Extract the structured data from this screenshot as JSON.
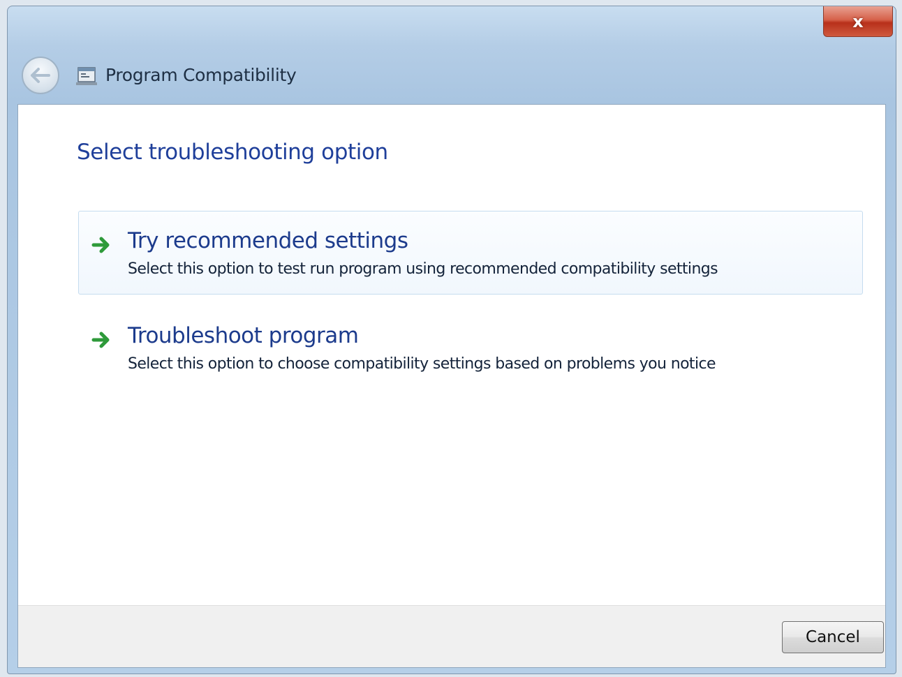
{
  "window": {
    "title": "Program Compatibility",
    "close_label": "x"
  },
  "icons": {
    "back": "back-arrow-icon",
    "app": "program-compatibility-icon",
    "option_arrow": "green-arrow-icon"
  },
  "main": {
    "heading": "Select troubleshooting option",
    "options": [
      {
        "title": "Try recommended settings",
        "description": "Select this option to test run program using recommended compatibility settings",
        "highlighted": true
      },
      {
        "title": "Troubleshoot program",
        "description": "Select this option to choose compatibility settings based on problems you notice",
        "highlighted": false
      }
    ]
  },
  "footer": {
    "cancel_label": "Cancel"
  },
  "colors": {
    "heading": "#1f3f9a",
    "option_title": "#1c3b8c",
    "close_button": "#c8452c",
    "arrow": "#2e9a3a"
  }
}
